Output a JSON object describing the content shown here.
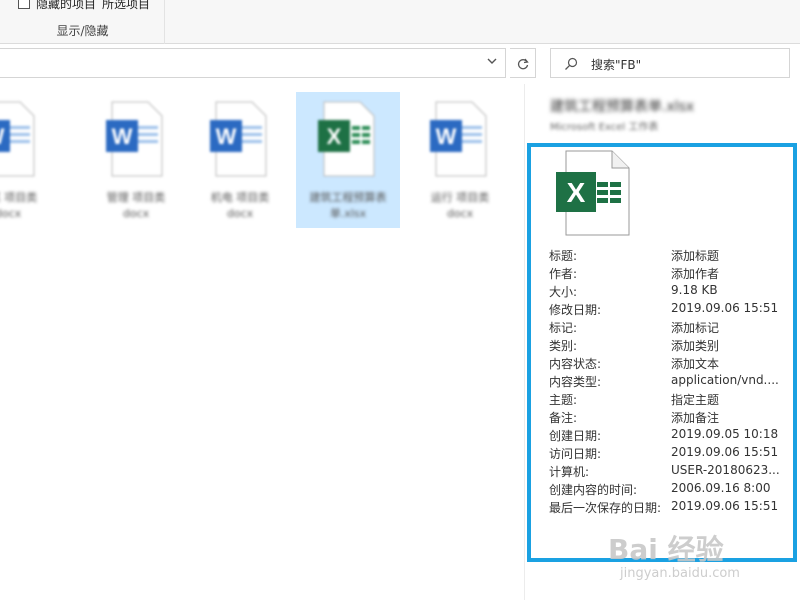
{
  "ribbon": {
    "hidden_items_label": "隐藏的项目",
    "hide_selected_label": "所选项目",
    "group_label": "显示/隐藏"
  },
  "address": {
    "dropdown_icon": "chevron-down-icon",
    "refresh_icon": "refresh-icon"
  },
  "search": {
    "placeholder": "搜索\"FB\""
  },
  "files": [
    {
      "line1": "某某 项目类",
      "line2": "docx",
      "type": "word"
    },
    {
      "line1": "管理 项目类",
      "line2": "docx",
      "type": "word"
    },
    {
      "line1": "机电 项目类",
      "line2": "docx",
      "type": "word"
    },
    {
      "line1": "建筑工程预算表",
      "line2": "单.xlsx",
      "type": "excel",
      "selected": true
    },
    {
      "line1": "运行 项目类",
      "line2": "docx",
      "type": "word"
    }
  ],
  "preview": {
    "name": "建筑工程预算表单.xlsx",
    "type": "Microsoft Excel 工作表"
  },
  "properties": [
    {
      "key": "标题:",
      "value": "添加标题"
    },
    {
      "key": "作者:",
      "value": "添加作者"
    },
    {
      "key": "大小:",
      "value": "9.18 KB"
    },
    {
      "key": "修改日期:",
      "value": "2019.09.06 15:51"
    },
    {
      "key": "标记:",
      "value": "添加标记"
    },
    {
      "key": "类别:",
      "value": "添加类别"
    },
    {
      "key": "内容状态:",
      "value": "添加文本"
    },
    {
      "key": "内容类型:",
      "value": "application/vnd...."
    },
    {
      "key": "主题:",
      "value": "指定主题"
    },
    {
      "key": "备注:",
      "value": "添加备注"
    },
    {
      "key": "创建日期:",
      "value": "2019.09.05 10:18"
    },
    {
      "key": "访问日期:",
      "value": "2019.09.06 15:51"
    },
    {
      "key": "计算机:",
      "value": "USER-20180623..."
    },
    {
      "key": "创建内容的时间:",
      "value": "2006.09.16 8:00"
    },
    {
      "key": "最后一次保存的日期:",
      "value": "2019.09.06 15:51"
    }
  ],
  "colors": {
    "highlight": "#1aa1e2",
    "excel_green": "#1e7145",
    "word_blue": "#2b579a",
    "selection": "#cce8ff"
  },
  "watermark": {
    "main": "Bai 经验",
    "sub": "jingyan.baidu.com"
  }
}
